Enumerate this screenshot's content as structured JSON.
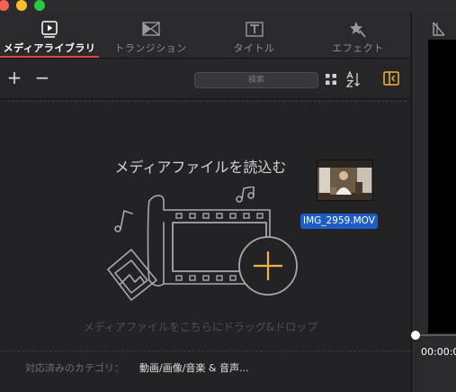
{
  "tabs": [
    {
      "label": "メディアライブラリ",
      "icon": "media-library-icon"
    },
    {
      "label": "トランジション",
      "icon": "transition-icon"
    },
    {
      "label": "タイトル",
      "icon": "title-icon"
    },
    {
      "label": "エフェクト",
      "icon": "effect-icon"
    }
  ],
  "toolbar": {
    "add_label": "+",
    "remove_label": "−",
    "search_placeholder": "検索",
    "icons": [
      "grid-view-icon",
      "sort-icon",
      "panel-toggle-icon"
    ]
  },
  "media": {
    "load_title": "メディアファイルを読込む",
    "drop_hint": "メディアファイルをこちらにドラッグ&ドロップ",
    "supported_label": "対応済みのカテゴリ：",
    "supported_value": "動画/画像/音楽 & 音声..."
  },
  "dragged_file": {
    "name": "IMG_2959.MOV"
  },
  "preview": {
    "timecode": "00:00:0"
  },
  "colors": {
    "accent": "#e0463f",
    "selection": "#1e5cc6",
    "plus_icon": "#f3b23a"
  }
}
